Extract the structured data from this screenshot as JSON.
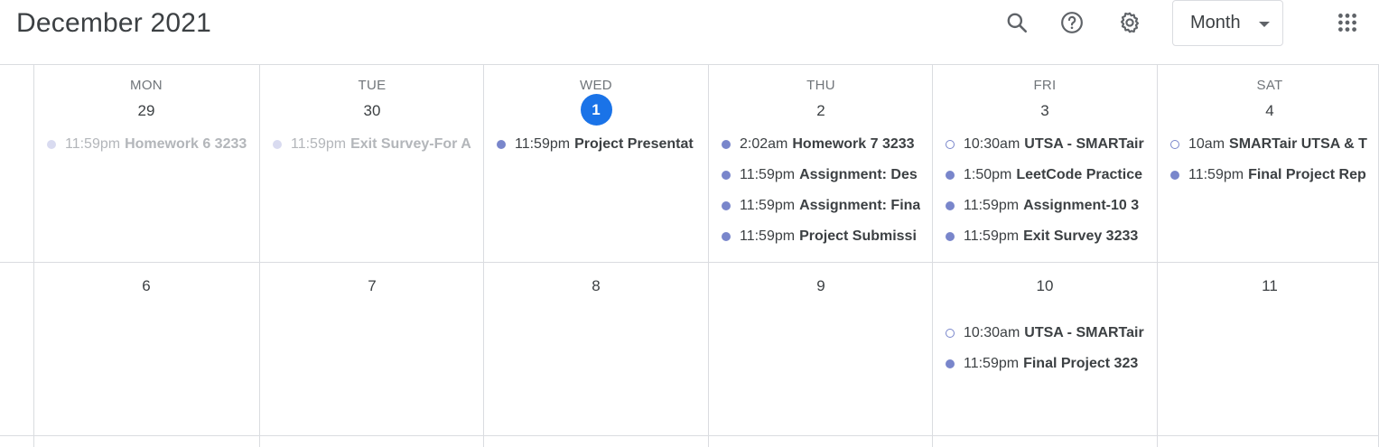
{
  "header": {
    "title": "December 2021",
    "view_label": "Month",
    "icons": [
      "search-icon",
      "help-icon",
      "settings-icon",
      "apps-icon"
    ]
  },
  "colors": {
    "today": "#1a73e8",
    "event_dot": "#7986cb",
    "past_dot": "#d9dbf0"
  },
  "week1": {
    "days": [
      {
        "dow": "MON",
        "num": "29",
        "events": [
          {
            "time": "11:59pm",
            "title": "Homework 6 3233",
            "style": "past"
          }
        ]
      },
      {
        "dow": "TUE",
        "num": "30",
        "events": [
          {
            "time": "11:59pm",
            "title": "Exit Survey-For A",
            "style": "past"
          }
        ]
      },
      {
        "dow": "WED",
        "num": "1",
        "today": true,
        "events": [
          {
            "time": "11:59pm",
            "title": "Project Presentat",
            "style": "filled"
          }
        ]
      },
      {
        "dow": "THU",
        "num": "2",
        "events": [
          {
            "time": "2:02am",
            "title": "Homework 7 3233",
            "style": "filled"
          },
          {
            "time": "11:59pm",
            "title": "Assignment: Des",
            "style": "filled"
          },
          {
            "time": "11:59pm",
            "title": "Assignment: Fina",
            "style": "filled"
          },
          {
            "time": "11:59pm",
            "title": "Project Submissi",
            "style": "filled"
          }
        ]
      },
      {
        "dow": "FRI",
        "num": "3",
        "events": [
          {
            "time": "10:30am",
            "title": "UTSA - SMARTair",
            "style": "outline"
          },
          {
            "time": "1:50pm",
            "title": "LeetCode Practice",
            "style": "filled"
          },
          {
            "time": "11:59pm",
            "title": "Assignment-10 3",
            "style": "filled"
          },
          {
            "time": "11:59pm",
            "title": "Exit Survey 3233",
            "style": "filled"
          }
        ]
      },
      {
        "dow": "SAT",
        "num": "4",
        "events": [
          {
            "time": "10am",
            "title": "SMARTair UTSA & T",
            "style": "outline"
          },
          {
            "time": "11:59pm",
            "title": "Final Project Rep",
            "style": "filled"
          }
        ]
      }
    ]
  },
  "week2": {
    "days": [
      {
        "num": "6",
        "events": []
      },
      {
        "num": "7",
        "events": []
      },
      {
        "num": "8",
        "events": []
      },
      {
        "num": "9",
        "events": []
      },
      {
        "num": "10",
        "events": [
          {
            "time": "10:30am",
            "title": "UTSA - SMARTair",
            "style": "outline"
          },
          {
            "time": "11:59pm",
            "title": "Final Project 323",
            "style": "filled"
          }
        ]
      },
      {
        "num": "11",
        "events": []
      }
    ]
  }
}
